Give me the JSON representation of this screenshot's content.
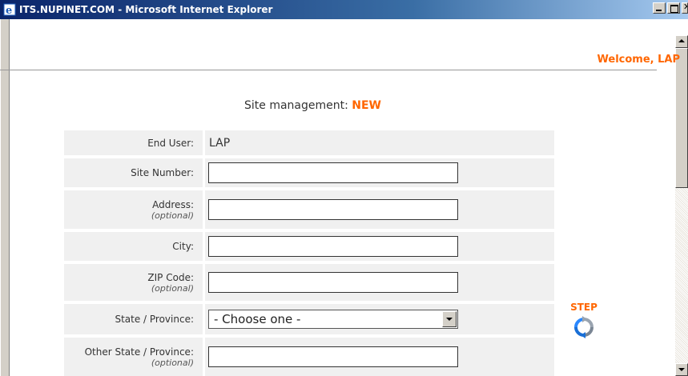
{
  "window": {
    "title": "ITS.NUPINET.COM - Microsoft Internet Explorer"
  },
  "header": {
    "welcome": "Welcome, LAP"
  },
  "page": {
    "heading_prefix": "Site management: ",
    "heading_status": "NEW"
  },
  "form": {
    "end_user_label": "End User:",
    "end_user_value": "LAP",
    "site_number_label": "Site Number:",
    "site_number_value": "",
    "address_label": "Address:",
    "address_optional": "(optional)",
    "address_value": "",
    "city_label": "City:",
    "city_value": "",
    "zip_label": "ZIP Code:",
    "zip_optional": "(optional)",
    "zip_value": "",
    "state_label": "State / Province:",
    "state_selected": "- Choose one -",
    "other_state_label": "Other State / Province:",
    "other_state_optional": "(optional)",
    "other_state_value": ""
  },
  "step": {
    "label": "STEP",
    "icon": "refresh-icon"
  },
  "colors": {
    "accent": "#ff6600",
    "row_bg": "#f0f0f0",
    "titlebar_start": "#0a246a",
    "titlebar_end": "#a6caf0"
  }
}
